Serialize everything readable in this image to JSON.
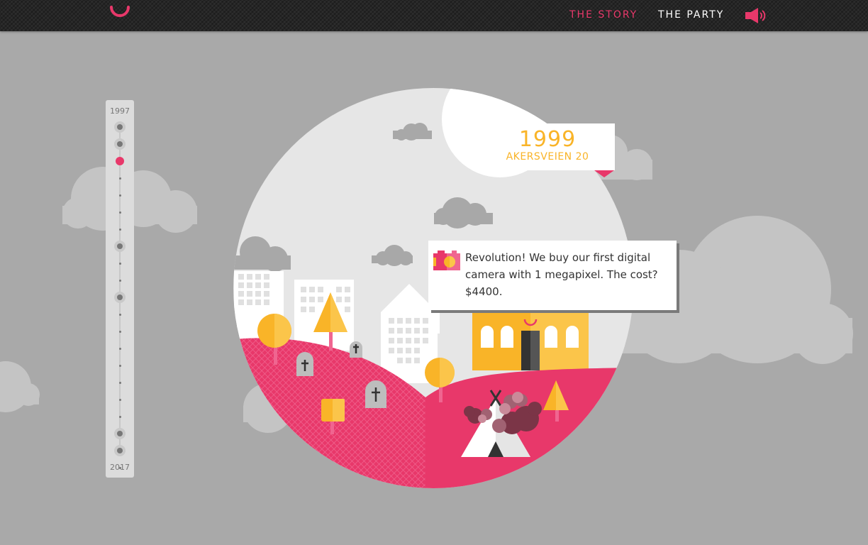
{
  "nav": {
    "story_label": "THE STORY",
    "party_label": "THE PARTY",
    "accent_color": "#e8386a"
  },
  "timeline": {
    "start_label": "1997",
    "end_label": "2017",
    "active_color": "#e8386a"
  },
  "event": {
    "year": "1999",
    "address": "AKERSVEIEN 20",
    "description": "Revolution! We buy our first digital camera with 1 megapixel. The cost? $4400.",
    "icon": "camera-icon"
  },
  "colors": {
    "background": "#a9a9a9",
    "pink": "#e8386a",
    "yellow": "#f9b428",
    "cloud": "#c3c3c3"
  }
}
